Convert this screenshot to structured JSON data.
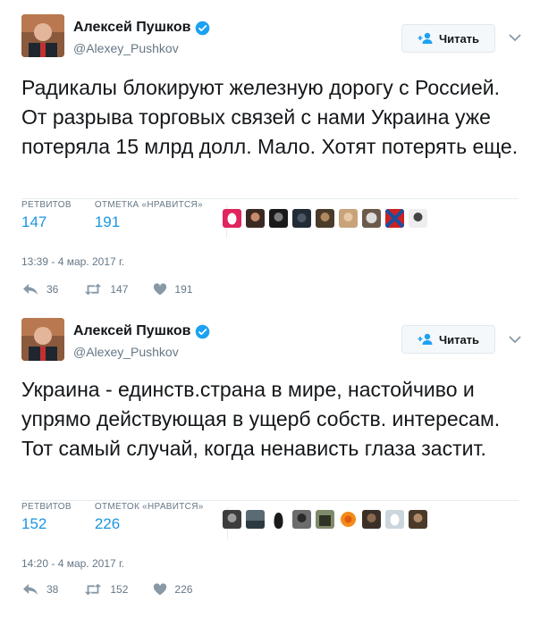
{
  "colors": {
    "accent": "#1b95e0",
    "muted": "#657786",
    "text": "#14171a",
    "verified": "#1da1f2"
  },
  "tweets": [
    {
      "author": {
        "name": "Алексей Пушков",
        "handle": "@Alexey_Pushkov",
        "verified_icon": "verified-badge-icon"
      },
      "follow_label": "Читать",
      "text": "Радикалы блокируют железную дорогу с Россией. От разрыва торговых связей с нами Украина уже потеряла 15 млрд долл. Мало. Хотят потерять еще.",
      "stats": {
        "retweets_label": "РЕТВИТОВ",
        "retweets": "147",
        "likes_label": "ОТМЕТКА «НРАВИТСЯ»",
        "likes": "191"
      },
      "likers": [
        "egg",
        "photo",
        "photo",
        "photo",
        "photo",
        "photo",
        "photo",
        "flag",
        "photo"
      ],
      "timestamp": "13:39 - 4 мар. 2017 г.",
      "actions": {
        "replies": "36",
        "retweets": "147",
        "likes": "191"
      }
    },
    {
      "author": {
        "name": "Алексей Пушков",
        "handle": "@Alexey_Pushkov",
        "verified_icon": "verified-badge-icon"
      },
      "follow_label": "Читать",
      "text": "Украина - единств.страна в мире, настойчиво и упрямо действующая в ущерб собств. интересам. Тот самый случай, когда ненависть глаза застит.",
      "stats": {
        "retweets_label": "РЕТВИТОВ",
        "retweets": "152",
        "likes_label": "ОТМЕТОК «НРАВИТСЯ»",
        "likes": "226"
      },
      "likers": [
        "photo",
        "photo",
        "photo",
        "photo",
        "photo",
        "sun",
        "photo",
        "egg",
        "photo"
      ],
      "timestamp": "14:20 - 4 мар. 2017 г.",
      "actions": {
        "replies": "38",
        "retweets": "152",
        "likes": "226"
      }
    }
  ]
}
